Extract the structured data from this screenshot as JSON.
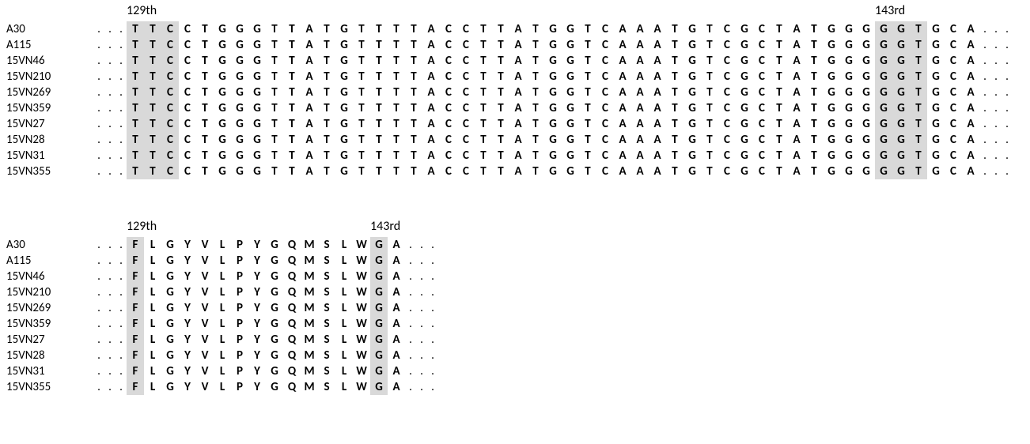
{
  "nucleotide": {
    "header": {
      "pos129": "129th",
      "pos143": "143rd"
    },
    "leadDots": 3,
    "trailDots": 3,
    "sequence_template": "TTCCTGGGTTATGTTTTACCTTATGGTCAAATGTCGCTATGGGGGTGCA",
    "highlight_ranges": [
      [
        0,
        2
      ],
      [
        43,
        45
      ]
    ],
    "samples": [
      "A30",
      "A115",
      "15VN46",
      "15VN210",
      "15VN269",
      "15VN359",
      "15VN27",
      "15VN28",
      "15VN31",
      "15VN355"
    ]
  },
  "protein": {
    "header": {
      "pos129": "129th",
      "pos143": "143rd"
    },
    "leadDots": 3,
    "trailDots": 3,
    "sequence_template": "FLGYVLPYGQMSLWGA",
    "highlight_ranges": [
      [
        0,
        0
      ],
      [
        14,
        14
      ]
    ],
    "samples": [
      "A30",
      "A115",
      "15VN46",
      "15VN210",
      "15VN269",
      "15VN359",
      "15VN27",
      "15VN28",
      "15VN31",
      "15VN355"
    ]
  }
}
